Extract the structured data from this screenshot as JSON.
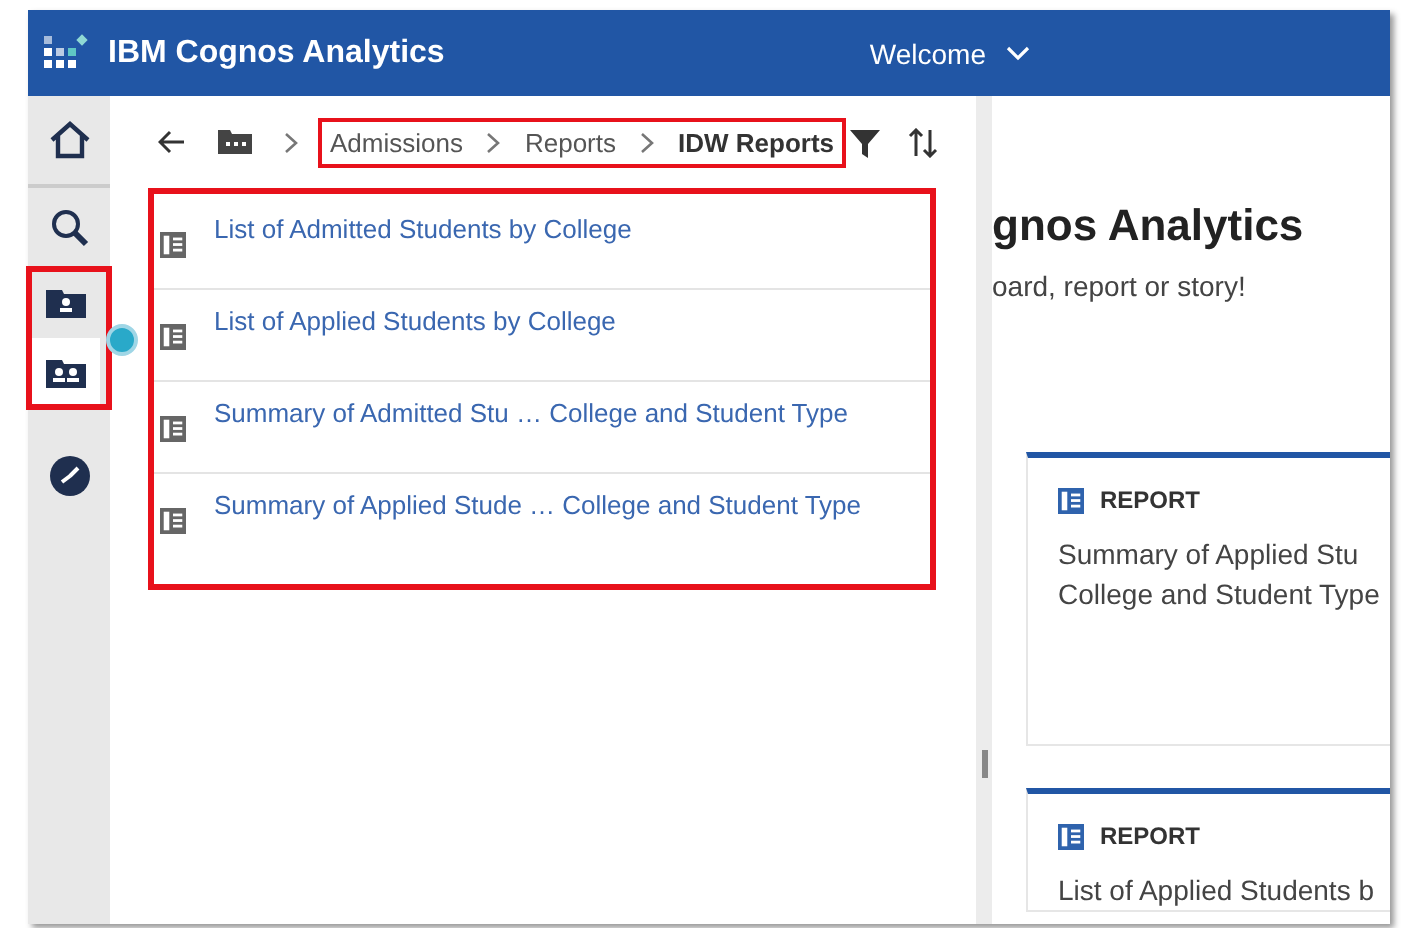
{
  "header": {
    "title": "IBM Cognos Analytics",
    "welcome": "Welcome"
  },
  "sidebar": {
    "items": [
      {
        "kind": "home",
        "selected": false,
        "highlighted": false
      },
      {
        "kind": "search",
        "selected": false,
        "highlighted": false
      },
      {
        "kind": "my-content",
        "selected": false,
        "highlighted": true
      },
      {
        "kind": "team-content",
        "selected": true,
        "highlighted": true
      },
      {
        "kind": "recent",
        "selected": false,
        "highlighted": false
      }
    ]
  },
  "breadcrumb": {
    "highlighted": true,
    "parts": [
      {
        "label": "Admissions",
        "current": false
      },
      {
        "label": "Reports",
        "current": false
      },
      {
        "label": "IDW Reports",
        "current": true
      }
    ]
  },
  "content_list": {
    "highlighted": true,
    "items": [
      {
        "title": "List of Admitted Students by College"
      },
      {
        "title": "List of Applied Students by College"
      },
      {
        "title": "Summary of Admitted Stu … College and Student Type"
      },
      {
        "title": "Summary of Applied Stude … College and Student Type"
      }
    ]
  },
  "welcome_panel": {
    "title": "gnos Analytics",
    "subtitle": "oard, report or story!",
    "cards": [
      {
        "type": "REPORT",
        "lines": [
          "Summary of Applied Stu",
          "College and Student Type"
        ]
      },
      {
        "type": "REPORT",
        "lines": [
          "List of Applied Students b"
        ]
      }
    ]
  }
}
